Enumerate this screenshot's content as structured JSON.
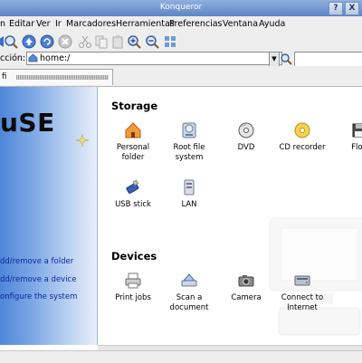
{
  "window": {
    "title": "Konqueror",
    "help_btn": "?",
    "close_btn": "X"
  },
  "menu": [
    "n",
    "Editar",
    "Ver",
    "Ir",
    "Marcadores",
    "Herramientas",
    "Preferencias",
    "Ventana",
    "Ayuda"
  ],
  "location": {
    "label": "cción:",
    "value": "home:/"
  },
  "tab": {
    "label": "fi"
  },
  "sidebar": {
    "brand": "uSE",
    "links": [
      "dd/remove a folder",
      "dd/remove a device",
      "onfigure the system"
    ]
  },
  "storage": {
    "title": "Storage",
    "items": [
      {
        "label": "Personal folder",
        "icon": "home-icon"
      },
      {
        "label": "Root file system",
        "icon": "harddisk-icon"
      },
      {
        "label": "DVD",
        "icon": "dvd-icon"
      },
      {
        "label": "CD recorder",
        "icon": "cd-recorder-icon"
      },
      {
        "label": "Flop",
        "icon": "floppy-icon"
      },
      {
        "label": "USB stick",
        "icon": "usb-stick-icon"
      },
      {
        "label": "LAN",
        "icon": "lan-icon"
      }
    ]
  },
  "devices": {
    "title": "Devices",
    "items": [
      {
        "label": "Print jobs",
        "icon": "printer-icon"
      },
      {
        "label": "Scan a document",
        "icon": "scanner-icon"
      },
      {
        "label": "Camera",
        "icon": "camera-icon"
      },
      {
        "label": "Connect to Internet",
        "icon": "network-icon"
      }
    ]
  },
  "colors": {
    "sidebar_blue": "#4e86d8",
    "link": "#0c2a9e",
    "titlebar": "#6f94cf"
  }
}
